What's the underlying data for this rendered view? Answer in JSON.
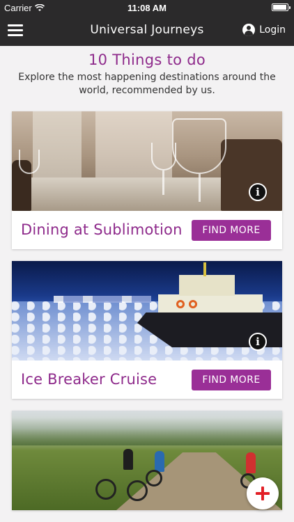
{
  "status_bar": {
    "carrier": "Carrier",
    "time": "11:08 AM",
    "battery_level": 0.95
  },
  "nav": {
    "title": "Universal Journeys",
    "login_label": "Login",
    "menu_icon": "hamburger-menu-icon",
    "login_icon": "user-circle-icon"
  },
  "header": {
    "title": "10 Things to do",
    "subtitle": "Explore the most happening destinations around the world, recommended by us."
  },
  "cards": [
    {
      "title": "Dining at Sublimotion",
      "button_label": "FIND MORE",
      "info_icon": "info-circle-icon"
    },
    {
      "title": "Ice Breaker Cruise",
      "button_label": "FIND MORE",
      "info_icon": "info-circle-icon"
    },
    {
      "title": "",
      "button_label": "",
      "info_icon": ""
    }
  ],
  "fab": {
    "icon": "plus-icon"
  },
  "colors": {
    "brand_purple": "#8e2a8b",
    "button_purple": "#9a2f97",
    "bar_dark": "#2b2a2b",
    "fab_plus_red": "#e21f26"
  }
}
